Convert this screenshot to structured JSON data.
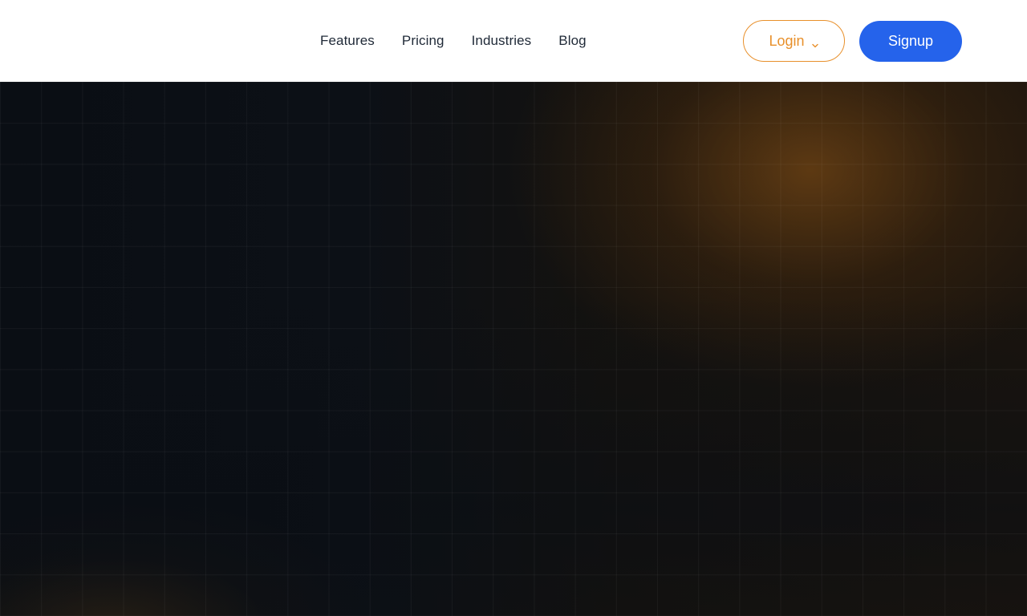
{
  "nav": {
    "links": [
      {
        "label": "Features"
      },
      {
        "label": "Pricing"
      },
      {
        "label": "Industries"
      },
      {
        "label": "Blog"
      }
    ],
    "login_label": "Login",
    "signup_label": "Signup"
  },
  "icons": {
    "login_dropdown": "chevron-down-icon"
  },
  "colors": {
    "login_accent": "#e8902b",
    "signup_bg": "#2563eb",
    "hero_bg": "#0a0e14",
    "hero_glow": "#784814"
  }
}
